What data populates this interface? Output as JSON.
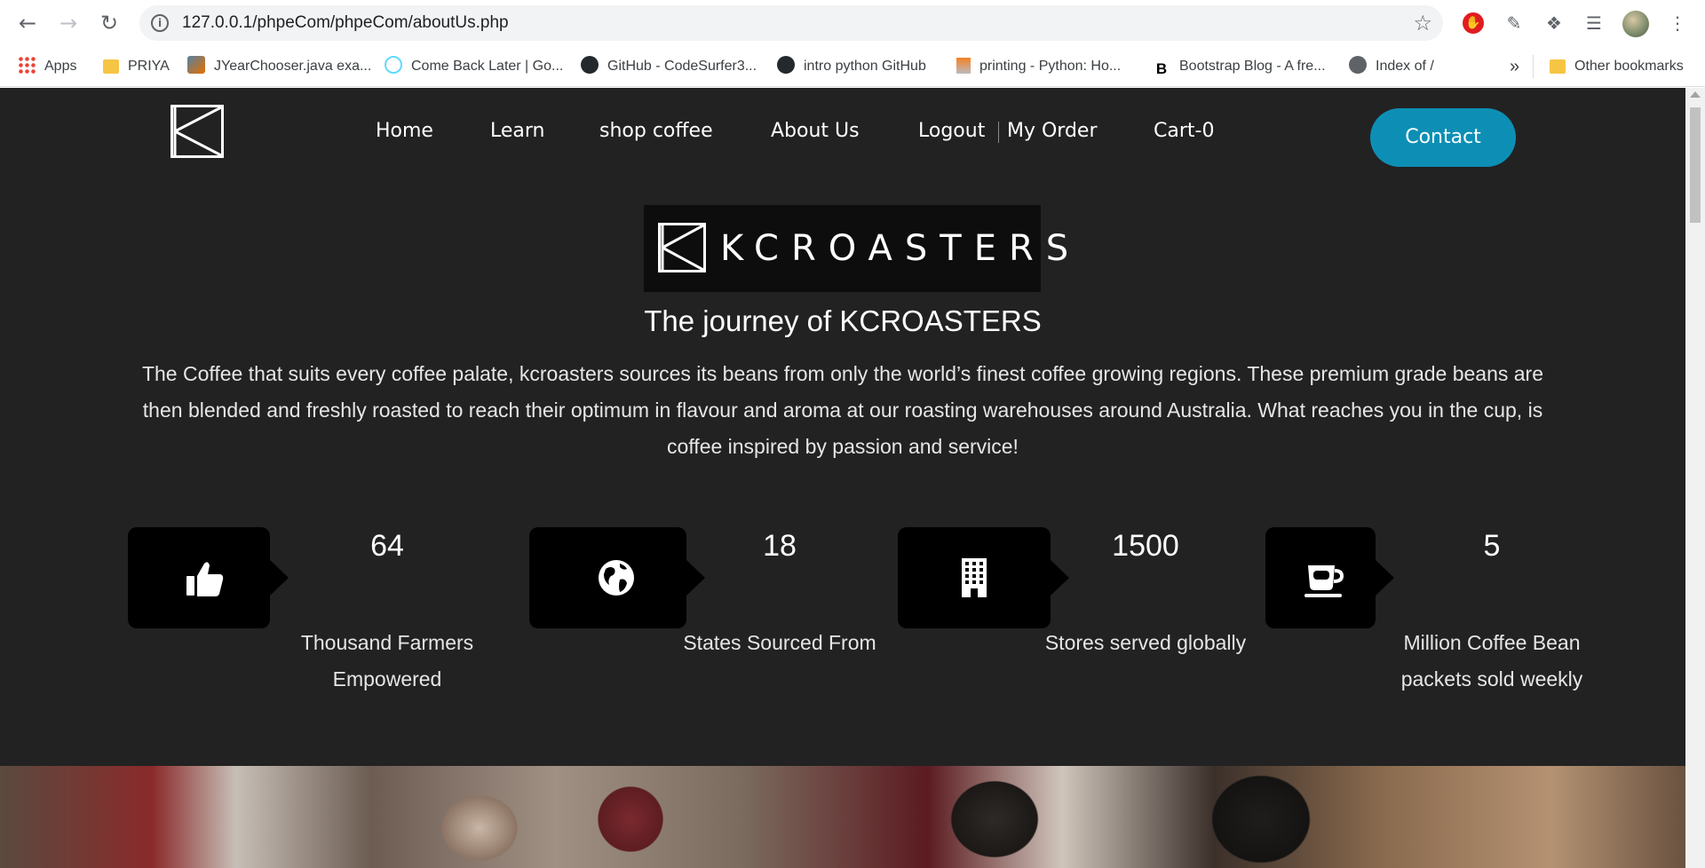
{
  "browser": {
    "url": "127.0.0.1/phpeCom/phpeCom/aboutUs.php",
    "bookmarks": [
      "Apps",
      "PRIYA",
      "JYearChooser.java exa...",
      "Come Back Later | Go...",
      "GitHub - CodeSurfer3...",
      "intro python GitHub",
      "printing - Python: Ho...",
      "Bootstrap Blog - A fre...",
      "Index of /"
    ],
    "overflow": "»",
    "other_bookmarks": "Other bookmarks"
  },
  "nav": {
    "items": [
      "Home",
      "Learn",
      "shop coffee",
      "About Us",
      "Logout",
      "My Order",
      "Cart-0"
    ],
    "contact": "Contact"
  },
  "brand": {
    "name": "KCROASTERS"
  },
  "about": {
    "heading": "The journey of KCROASTERS",
    "intro": "The Coffee that suits every coffee palate, kcroasters sources its beans from only the world’s finest coffee growing regions. These premium grade beans are then blended and freshly roasted to reach their optimum in flavour and aroma at our roasting warehouses around Australia. What reaches you in the cup, is coffee inspired by passion and service!"
  },
  "stats": [
    {
      "icon": "thumbs-up-icon",
      "value": "64",
      "label": "Thousand Farmers Empowered"
    },
    {
      "icon": "globe-icon",
      "value": "18",
      "label": "States Sourced From"
    },
    {
      "icon": "building-icon",
      "value": "1500",
      "label": "Stores served globally"
    },
    {
      "icon": "coffee-cup-icon",
      "value": "5",
      "label": "Million Coffee Bean packets sold weekly"
    }
  ],
  "colors": {
    "page_bg": "#222222",
    "stat_box": "#000000",
    "contact_button": "#0d8fb5"
  }
}
